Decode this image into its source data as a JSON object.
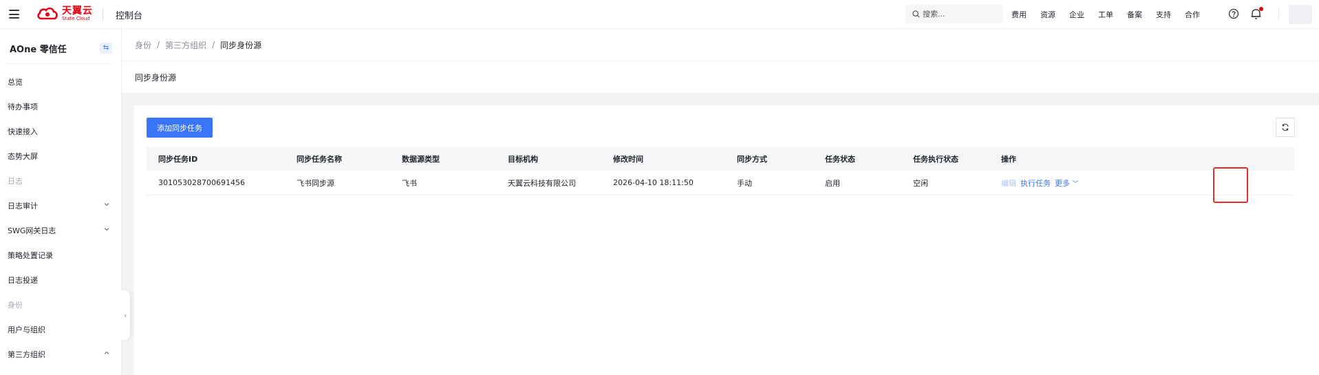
{
  "topbar": {
    "logo_cn": "天翼云",
    "logo_en": "State Cloud",
    "console": "控制台",
    "search_placeholder": "搜索...",
    "links": [
      "费用",
      "资源",
      "企业",
      "工单",
      "备案",
      "支持",
      "合作"
    ]
  },
  "sidebar": {
    "title": "AOne 零信任",
    "toggle_icon": "⇆",
    "items": [
      {
        "label": "总览",
        "type": "item"
      },
      {
        "label": "待办事项",
        "type": "item"
      },
      {
        "label": "快速接入",
        "type": "item"
      },
      {
        "label": "态势大屏",
        "type": "item"
      },
      {
        "label": "日志",
        "type": "group"
      },
      {
        "label": "日志审计",
        "type": "item",
        "chevron": "down"
      },
      {
        "label": "SWG网关日志",
        "type": "item",
        "chevron": "down"
      },
      {
        "label": "策略处置记录",
        "type": "item"
      },
      {
        "label": "日志投递",
        "type": "item"
      },
      {
        "label": "身份",
        "type": "group"
      },
      {
        "label": "用户与组织",
        "type": "item"
      },
      {
        "label": "第三方组织",
        "type": "item",
        "chevron": "up"
      }
    ]
  },
  "breadcrumb": {
    "items": [
      "身份",
      "第三方组织"
    ],
    "current": "同步身份源"
  },
  "page": {
    "title": "同步身份源",
    "add_button": "添加同步任务"
  },
  "table": {
    "headers": [
      "同步任务ID",
      "同步任务名称",
      "数据源类型",
      "目标机构",
      "修改时间",
      "同步方式",
      "任务状态",
      "任务执行状态",
      "操作"
    ],
    "rows": [
      {
        "id": "301053028700691456",
        "name": "飞书同步源",
        "source": "飞书",
        "org": "天翼云科技有限公司",
        "modified": "2026-04-10 18:11:50",
        "mode": "手动",
        "status": "启用",
        "exec_status": "空闲",
        "actions": {
          "edit": "编辑",
          "run": "执行任务",
          "more": "更多"
        }
      }
    ]
  },
  "colors": {
    "primary": "#3a75f7",
    "brand_red": "#e60012",
    "highlight_box": "#e0312a"
  }
}
